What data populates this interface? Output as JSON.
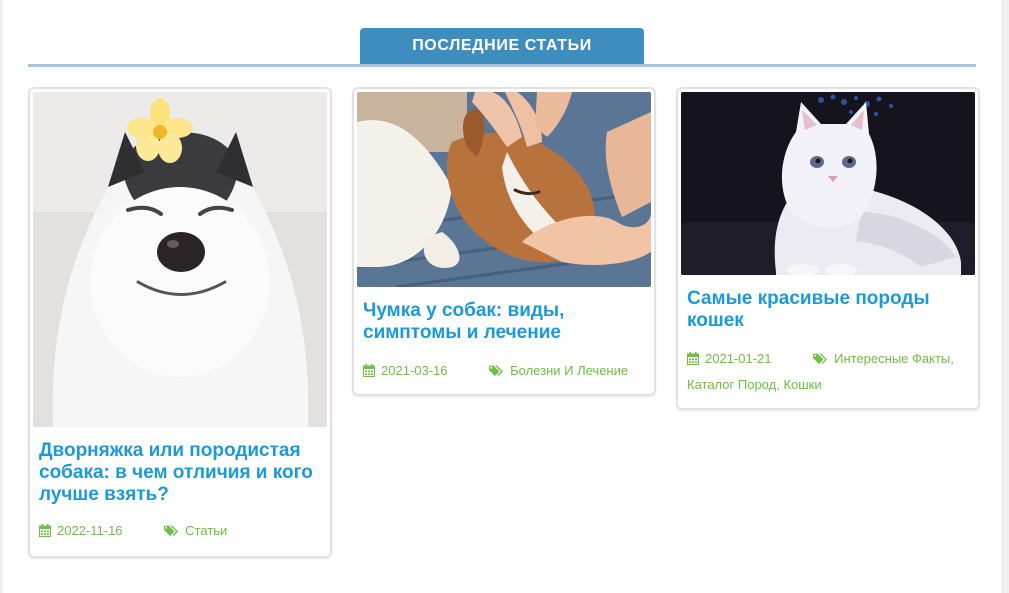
{
  "section": {
    "title": "ПОСЛЕДНИЕ СТАТЬИ"
  },
  "articles": [
    {
      "title": "Дворняжка или породистая собака: в чем отличия и кого лучше взять?",
      "image": "husky-with-flower",
      "date": "2022-11-16",
      "categories": [
        "Статьи"
      ]
    },
    {
      "title": "Чумка у собак: виды, симптомы и лечение",
      "image": "dog-held-in-hands",
      "date": "2021-03-16",
      "categories": [
        "Болезни И Лечение"
      ]
    },
    {
      "title": "Самые красивые породы кошек",
      "image": "white-fluffy-cat",
      "date": "2021-01-21",
      "categories": [
        "Интересные Факты",
        "Каталог Пород",
        "Кошки"
      ]
    }
  ],
  "colors": {
    "accent": "#3d8dbf",
    "title": "#1b9ad9",
    "meta": "#6fbe45",
    "rule": "#a7c5df"
  },
  "icons": {
    "date": "calendar-icon",
    "tags": "tags-icon"
  }
}
